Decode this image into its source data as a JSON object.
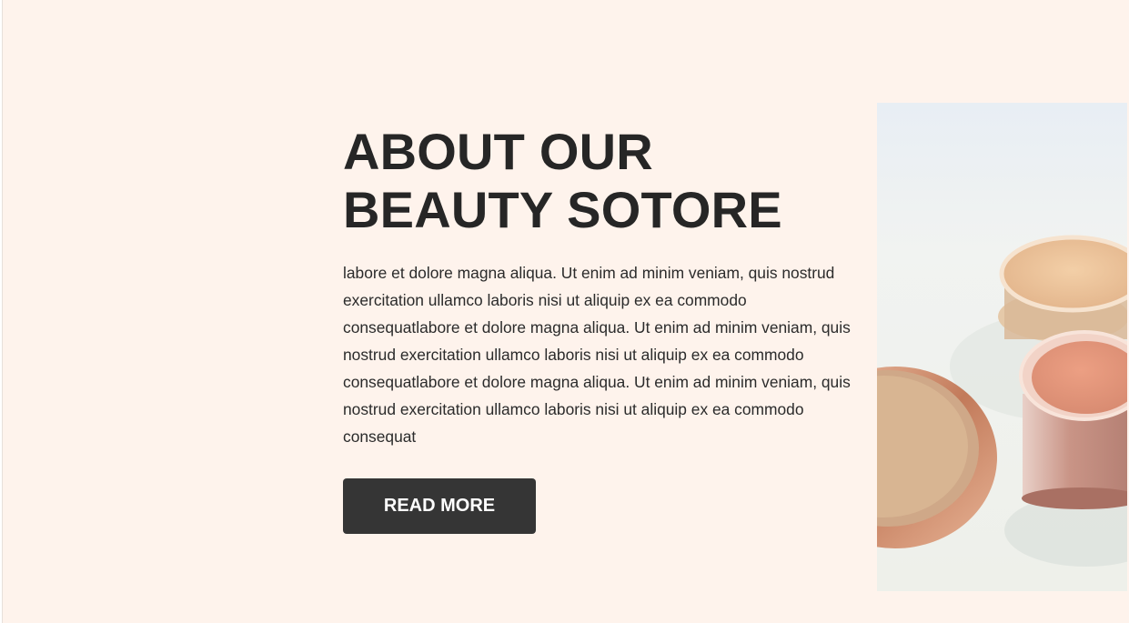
{
  "about": {
    "title_line1": "ABOUT OUR",
    "title_line2": "BEAUTY SOTORE",
    "body": "labore et dolore magna aliqua. Ut enim ad minim veniam, quis nostrud exercitation ullamco laboris nisi ut aliquip ex ea commodo consequatlabore et dolore magna aliqua. Ut enim ad minim veniam, quis nostrud exercitation ullamco laboris nisi ut aliquip ex ea commodo consequatlabore et dolore magna aliqua. Ut enim ad minim veniam, quis nostrud exercitation ullamco laboris nisi ut aliquip ex ea commodo consequat",
    "button_label": "READ MORE"
  },
  "image": {
    "subject": "cosmetic-powder-jars-photo"
  },
  "colors": {
    "background": "#fef3ec",
    "heading": "#262626",
    "button_bg": "#353535",
    "button_text": "#ffffff"
  }
}
